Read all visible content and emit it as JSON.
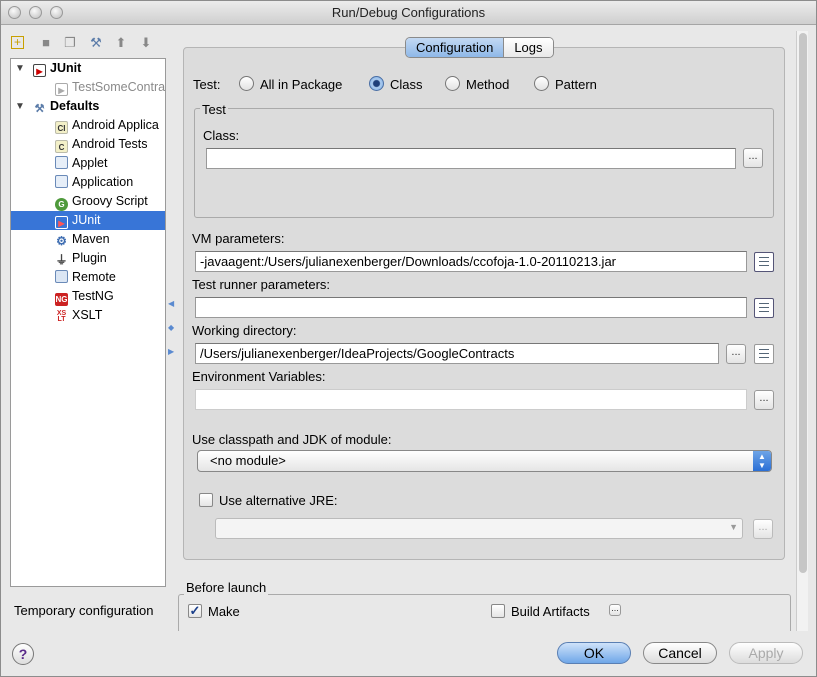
{
  "window": {
    "title": "Run/Debug Configurations"
  },
  "toolbar": {
    "icons": [
      "add-icon",
      "remove-icon",
      "copy-icon",
      "edit-defaults-icon",
      "move-up-icon",
      "move-down-icon"
    ]
  },
  "tree": {
    "junit_group": "JUnit",
    "junit_child": "TestSomeContra",
    "defaults_group": "Defaults",
    "defaults_items": [
      {
        "label": "Android Applica",
        "icon": "android-app-icon"
      },
      {
        "label": "Android Tests",
        "icon": "android-tests-icon"
      },
      {
        "label": "Applet",
        "icon": "applet-icon"
      },
      {
        "label": "Application",
        "icon": "application-icon"
      },
      {
        "label": "Groovy Script",
        "icon": "groovy-icon"
      },
      {
        "label": "JUnit",
        "icon": "junit-icon",
        "selected": true
      },
      {
        "label": "Maven",
        "icon": "maven-icon"
      },
      {
        "label": "Plugin",
        "icon": "plugin-icon"
      },
      {
        "label": "Remote",
        "icon": "remote-icon"
      },
      {
        "label": "TestNG",
        "icon": "testng-icon"
      },
      {
        "label": "XSLT",
        "icon": "xslt-icon"
      }
    ]
  },
  "temporary_label": "Temporary configuration",
  "tabs": {
    "configuration": "Configuration",
    "logs": "Logs"
  },
  "test_kind": {
    "label": "Test:",
    "options": [
      "All in Package",
      "Class",
      "Method",
      "Pattern"
    ],
    "selected": "Class"
  },
  "test_group": {
    "title": "Test",
    "class_label": "Class:",
    "class_value": ""
  },
  "vm_parameters": {
    "label": "VM parameters:",
    "value": "-javaagent:/Users/julianexenberger/Downloads/ccofoja-1.0-20110213.jar"
  },
  "runner_parameters": {
    "label": "Test runner parameters:",
    "value": ""
  },
  "working_directory": {
    "label": "Working directory:",
    "value": "/Users/julianexenberger/IdeaProjects/GoogleContracts"
  },
  "env_vars": {
    "label": "Environment Variables:",
    "value": ""
  },
  "module": {
    "label": "Use classpath and JDK of module:",
    "value": "<no module>"
  },
  "alt_jre": {
    "label": "Use alternative JRE:",
    "checked": false,
    "value": ""
  },
  "before_launch": {
    "title": "Before launch",
    "make": "Make",
    "make_checked": true,
    "build_artifacts": "Build Artifacts",
    "build_checked": false
  },
  "buttons": {
    "ok": "OK",
    "cancel": "Cancel",
    "apply": "Apply",
    "help": "?",
    "ellipsis": "..."
  }
}
